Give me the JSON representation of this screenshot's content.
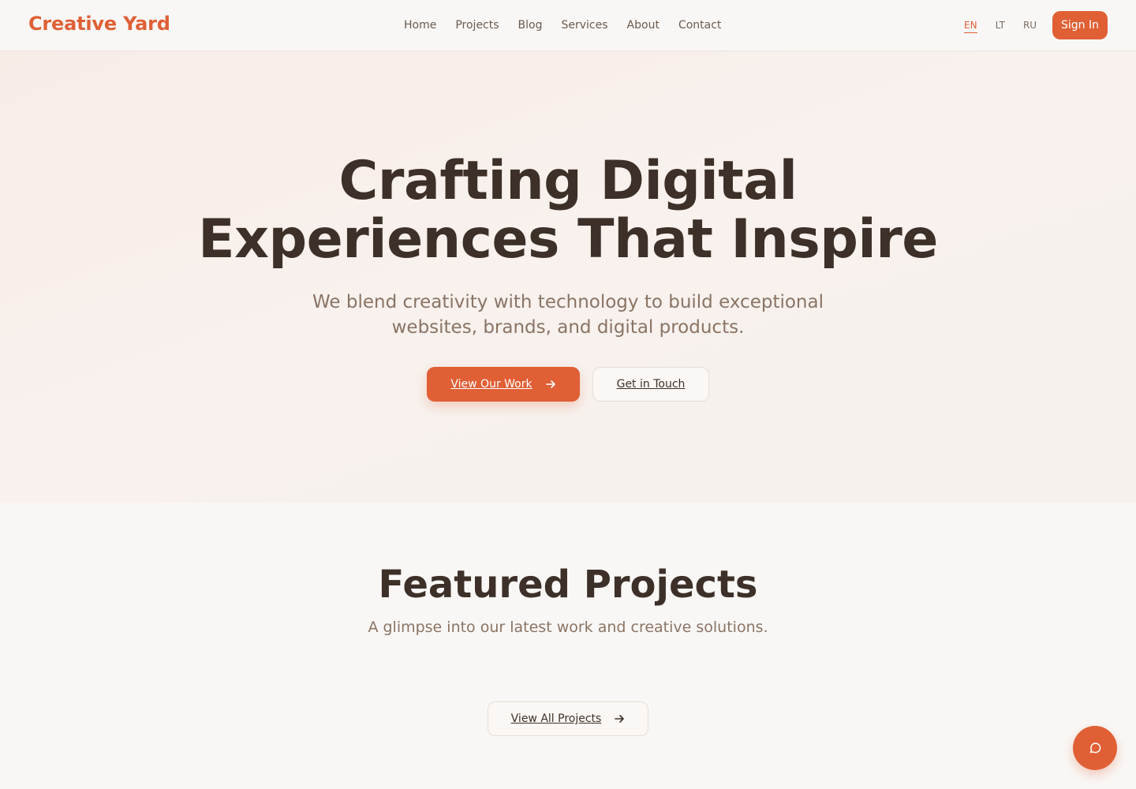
{
  "brand": {
    "name": "Creative Yard",
    "accent_color": "#e05f35"
  },
  "nav": {
    "items": [
      {
        "label": "Home"
      },
      {
        "label": "Projects"
      },
      {
        "label": "Blog"
      },
      {
        "label": "Services"
      },
      {
        "label": "About"
      },
      {
        "label": "Contact"
      }
    ]
  },
  "languages": {
    "items": [
      "EN",
      "LT",
      "RU"
    ],
    "active": "EN"
  },
  "auth": {
    "sign_in_label": "Sign In"
  },
  "hero": {
    "title_line1": "Crafting Digital",
    "title_line2": "Experiences That Inspire",
    "subtitle_line1": "We blend creativity with technology to build exceptional",
    "subtitle_line2": "websites, brands, and digital products.",
    "primary_cta": "View Our Work",
    "secondary_cta": "Get in Touch"
  },
  "featured": {
    "title": "Featured Projects",
    "subtitle": "A glimpse into our latest work and creative solutions.",
    "view_all_label": "View All Projects"
  },
  "icons": {
    "arrow": "arrow-right-icon",
    "chat": "chat-bubble-icon"
  }
}
